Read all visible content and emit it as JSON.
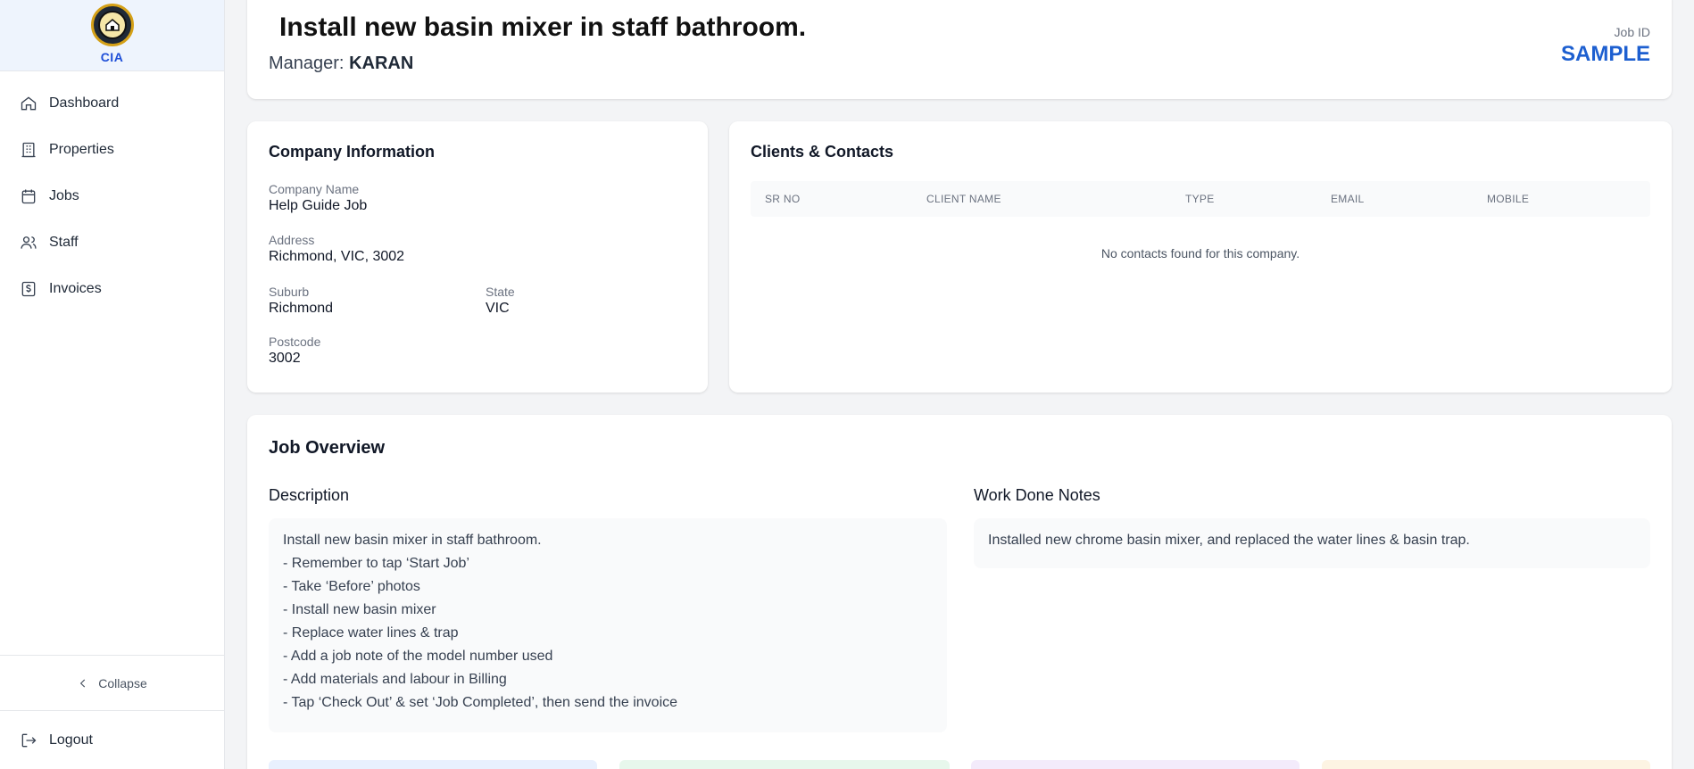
{
  "brand": {
    "name": "CIA",
    "logo_icon": "company-seal-logo"
  },
  "sidebar": {
    "items": [
      {
        "label": "Dashboard",
        "icon": "home-icon"
      },
      {
        "label": "Properties",
        "icon": "building-icon"
      },
      {
        "label": "Jobs",
        "icon": "calendar-icon"
      },
      {
        "label": "Staff",
        "icon": "users-icon"
      },
      {
        "label": "Invoices",
        "icon": "invoice-icon"
      }
    ],
    "collapse_label": "Collapse",
    "logout_label": "Logout"
  },
  "header": {
    "title": "Install new basin mixer in staff bathroom.",
    "manager_label": "Manager:",
    "manager_name": "KARAN",
    "job_id_label": "Job ID",
    "job_id_value": "SAMPLE"
  },
  "company": {
    "title": "Company Information",
    "company_name_label": "Company Name",
    "company_name": "Help Guide Job",
    "address_label": "Address",
    "address": "Richmond, VIC, 3002",
    "suburb_label": "Suburb",
    "suburb": "Richmond",
    "state_label": "State",
    "state": "VIC",
    "postcode_label": "Postcode",
    "postcode": "3002"
  },
  "clients": {
    "title": "Clients & Contacts",
    "columns": [
      "SR NO",
      "CLIENT NAME",
      "TYPE",
      "EMAIL",
      "MOBILE"
    ],
    "empty_message": "No contacts found for this company."
  },
  "overview": {
    "title": "Job Overview",
    "description_title": "Description",
    "description_lines": [
      "Install new basin mixer in staff bathroom.",
      "- Remember to tap ‘Start Job’",
      "- Take ‘Before’ photos",
      "- Install new basin mixer",
      "- Replace water lines & trap",
      "- Add a job note of the model number used",
      "- Add materials and labour in Billing",
      "- Tap ‘Check Out’ & set ‘Job Completed’, then send the invoice"
    ],
    "work_notes_title": "Work Done Notes",
    "work_notes": "Installed new chrome basin mixer, and replaced the water lines & basin trap."
  },
  "colors": {
    "accent": "#1d5fd0",
    "brand_bg": "#eef4fd",
    "tile_blue": "#e8f0fe",
    "tile_green": "#e7f7ec",
    "tile_purple": "#f3ebfb",
    "tile_amber": "#fdf4e3"
  }
}
